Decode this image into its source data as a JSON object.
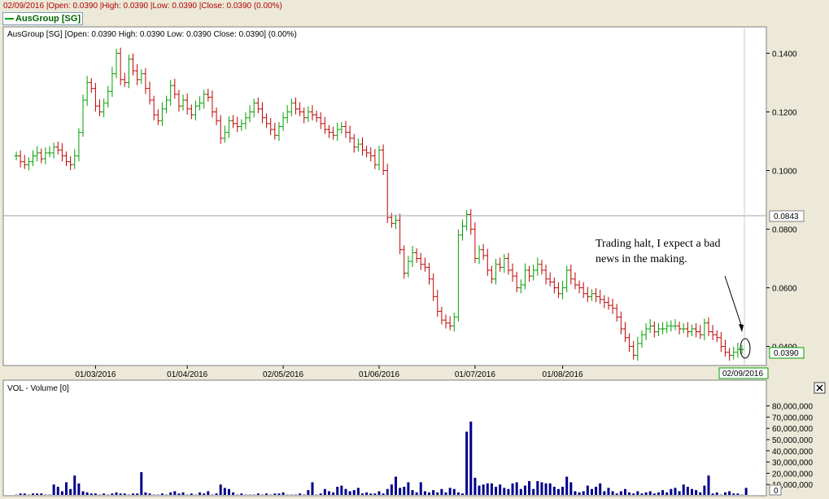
{
  "header": {
    "status_line": "02/09/2016 |Open: 0.0390 |High: 0.0390 |Low: 0.0390 |Close: 0.0390 (0.00%)",
    "tab_label": "AusGroup [SG]"
  },
  "chart_data": {
    "type": "ohlc",
    "title": "AusGroup [SG] [Open: 0.0390  High: 0.0390  Low: 0.0390  Close: 0.0390] (0.00%)",
    "up_color": "#00A000",
    "down_color": "#C00000",
    "crosshair_value": "0.0843",
    "last_value": "0.0390",
    "cursor_date": "02/09/2016",
    "y_ticks": [
      "0.0400",
      "0.0600",
      "0.0800",
      "0.1000",
      "0.1200",
      "0.1400"
    ],
    "ylim": [
      0.0335,
      0.149
    ],
    "x_ticks": [
      "01/03/2016",
      "01/04/2016",
      "02/05/2016",
      "01/06/2016",
      "01/07/2016",
      "01/08/2016"
    ],
    "annotation": [
      "Trading halt, I expect a bad",
      "news in the making."
    ],
    "volume": {
      "title": "VOL - Volume [0]",
      "y_ticks": [
        "10,000,000",
        "20,000,000",
        "30,000,000",
        "40,000,000",
        "50,000,000",
        "60,000,000",
        "70,000,000",
        "80,000,000"
      ],
      "ylim": [
        0,
        100000000
      ],
      "last_label": "0",
      "color": "#00008B"
    },
    "close": [
      0.105,
      0.103,
      0.102,
      0.103,
      0.105,
      0.106,
      0.104,
      0.106,
      0.106,
      0.108,
      0.107,
      0.105,
      0.103,
      0.102,
      0.105,
      0.113,
      0.124,
      0.13,
      0.128,
      0.122,
      0.12,
      0.123,
      0.127,
      0.133,
      0.14,
      0.131,
      0.13,
      0.138,
      0.134,
      0.131,
      0.133,
      0.128,
      0.124,
      0.119,
      0.117,
      0.121,
      0.124,
      0.129,
      0.126,
      0.122,
      0.124,
      0.121,
      0.119,
      0.122,
      0.123,
      0.126,
      0.125,
      0.12,
      0.117,
      0.111,
      0.113,
      0.117,
      0.116,
      0.115,
      0.116,
      0.118,
      0.12,
      0.123,
      0.121,
      0.118,
      0.116,
      0.114,
      0.112,
      0.115,
      0.118,
      0.12,
      0.123,
      0.121,
      0.12,
      0.118,
      0.12,
      0.119,
      0.118,
      0.116,
      0.114,
      0.113,
      0.112,
      0.114,
      0.115,
      0.113,
      0.111,
      0.108,
      0.109,
      0.107,
      0.106,
      0.105,
      0.102,
      0.107,
      0.1,
      0.084,
      0.082,
      0.083,
      0.073,
      0.065,
      0.069,
      0.072,
      0.07,
      0.068,
      0.067,
      0.063,
      0.057,
      0.052,
      0.049,
      0.048,
      0.047,
      0.05,
      0.078,
      0.081,
      0.085,
      0.08,
      0.07,
      0.073,
      0.071,
      0.066,
      0.063,
      0.068,
      0.067,
      0.07,
      0.066,
      0.064,
      0.06,
      0.061,
      0.066,
      0.064,
      0.066,
      0.068,
      0.066,
      0.063,
      0.062,
      0.06,
      0.058,
      0.06,
      0.066,
      0.063,
      0.061,
      0.06,
      0.058,
      0.057,
      0.058,
      0.057,
      0.056,
      0.055,
      0.054,
      0.053,
      0.05,
      0.046,
      0.043,
      0.04,
      0.037,
      0.041,
      0.044,
      0.046,
      0.047,
      0.045,
      0.046,
      0.046,
      0.047,
      0.047,
      0.047,
      0.046,
      0.046,
      0.045,
      0.046,
      0.045,
      0.044,
      0.048,
      0.045,
      0.044,
      0.043,
      0.04,
      0.038,
      0.037,
      0.038,
      0.039,
      0.039
    ],
    "volume_data": [
      1,
      2,
      2,
      1,
      2,
      2,
      2,
      1,
      1,
      10,
      8,
      4,
      12,
      6,
      18,
      11,
      4,
      3,
      2,
      2,
      1,
      2,
      1,
      2,
      3,
      2,
      2,
      1,
      2,
      2,
      21,
      3,
      2,
      1,
      1,
      2,
      1,
      3,
      4,
      2,
      3,
      1,
      2,
      1,
      3,
      2,
      4,
      1,
      2,
      10,
      7,
      6,
      3,
      1,
      2,
      1,
      1,
      1,
      2,
      1,
      2,
      1,
      2,
      2,
      3,
      1,
      1,
      1,
      2,
      1,
      5,
      12,
      1,
      2,
      6,
      4,
      3,
      8,
      9,
      6,
      4,
      5,
      7,
      2,
      3,
      2,
      2,
      4,
      2,
      6,
      10,
      17,
      7,
      8,
      12,
      5,
      3,
      12,
      4,
      3,
      5,
      3,
      6,
      3,
      7,
      6,
      3,
      2,
      57,
      66,
      16,
      9,
      10,
      11,
      11,
      8,
      10,
      7,
      6,
      11,
      12,
      6,
      9,
      13,
      6,
      13,
      12,
      11,
      11,
      8,
      6,
      8,
      17,
      12,
      4,
      3,
      4,
      9,
      6,
      8,
      11,
      4,
      7,
      4,
      2,
      4,
      6,
      3,
      2,
      4,
      2,
      3,
      4,
      2,
      3,
      5,
      3,
      6,
      7,
      4,
      10,
      8,
      6,
      5,
      3,
      9,
      18,
      2,
      3,
      1,
      3,
      4,
      2,
      2,
      1,
      7
    ]
  }
}
